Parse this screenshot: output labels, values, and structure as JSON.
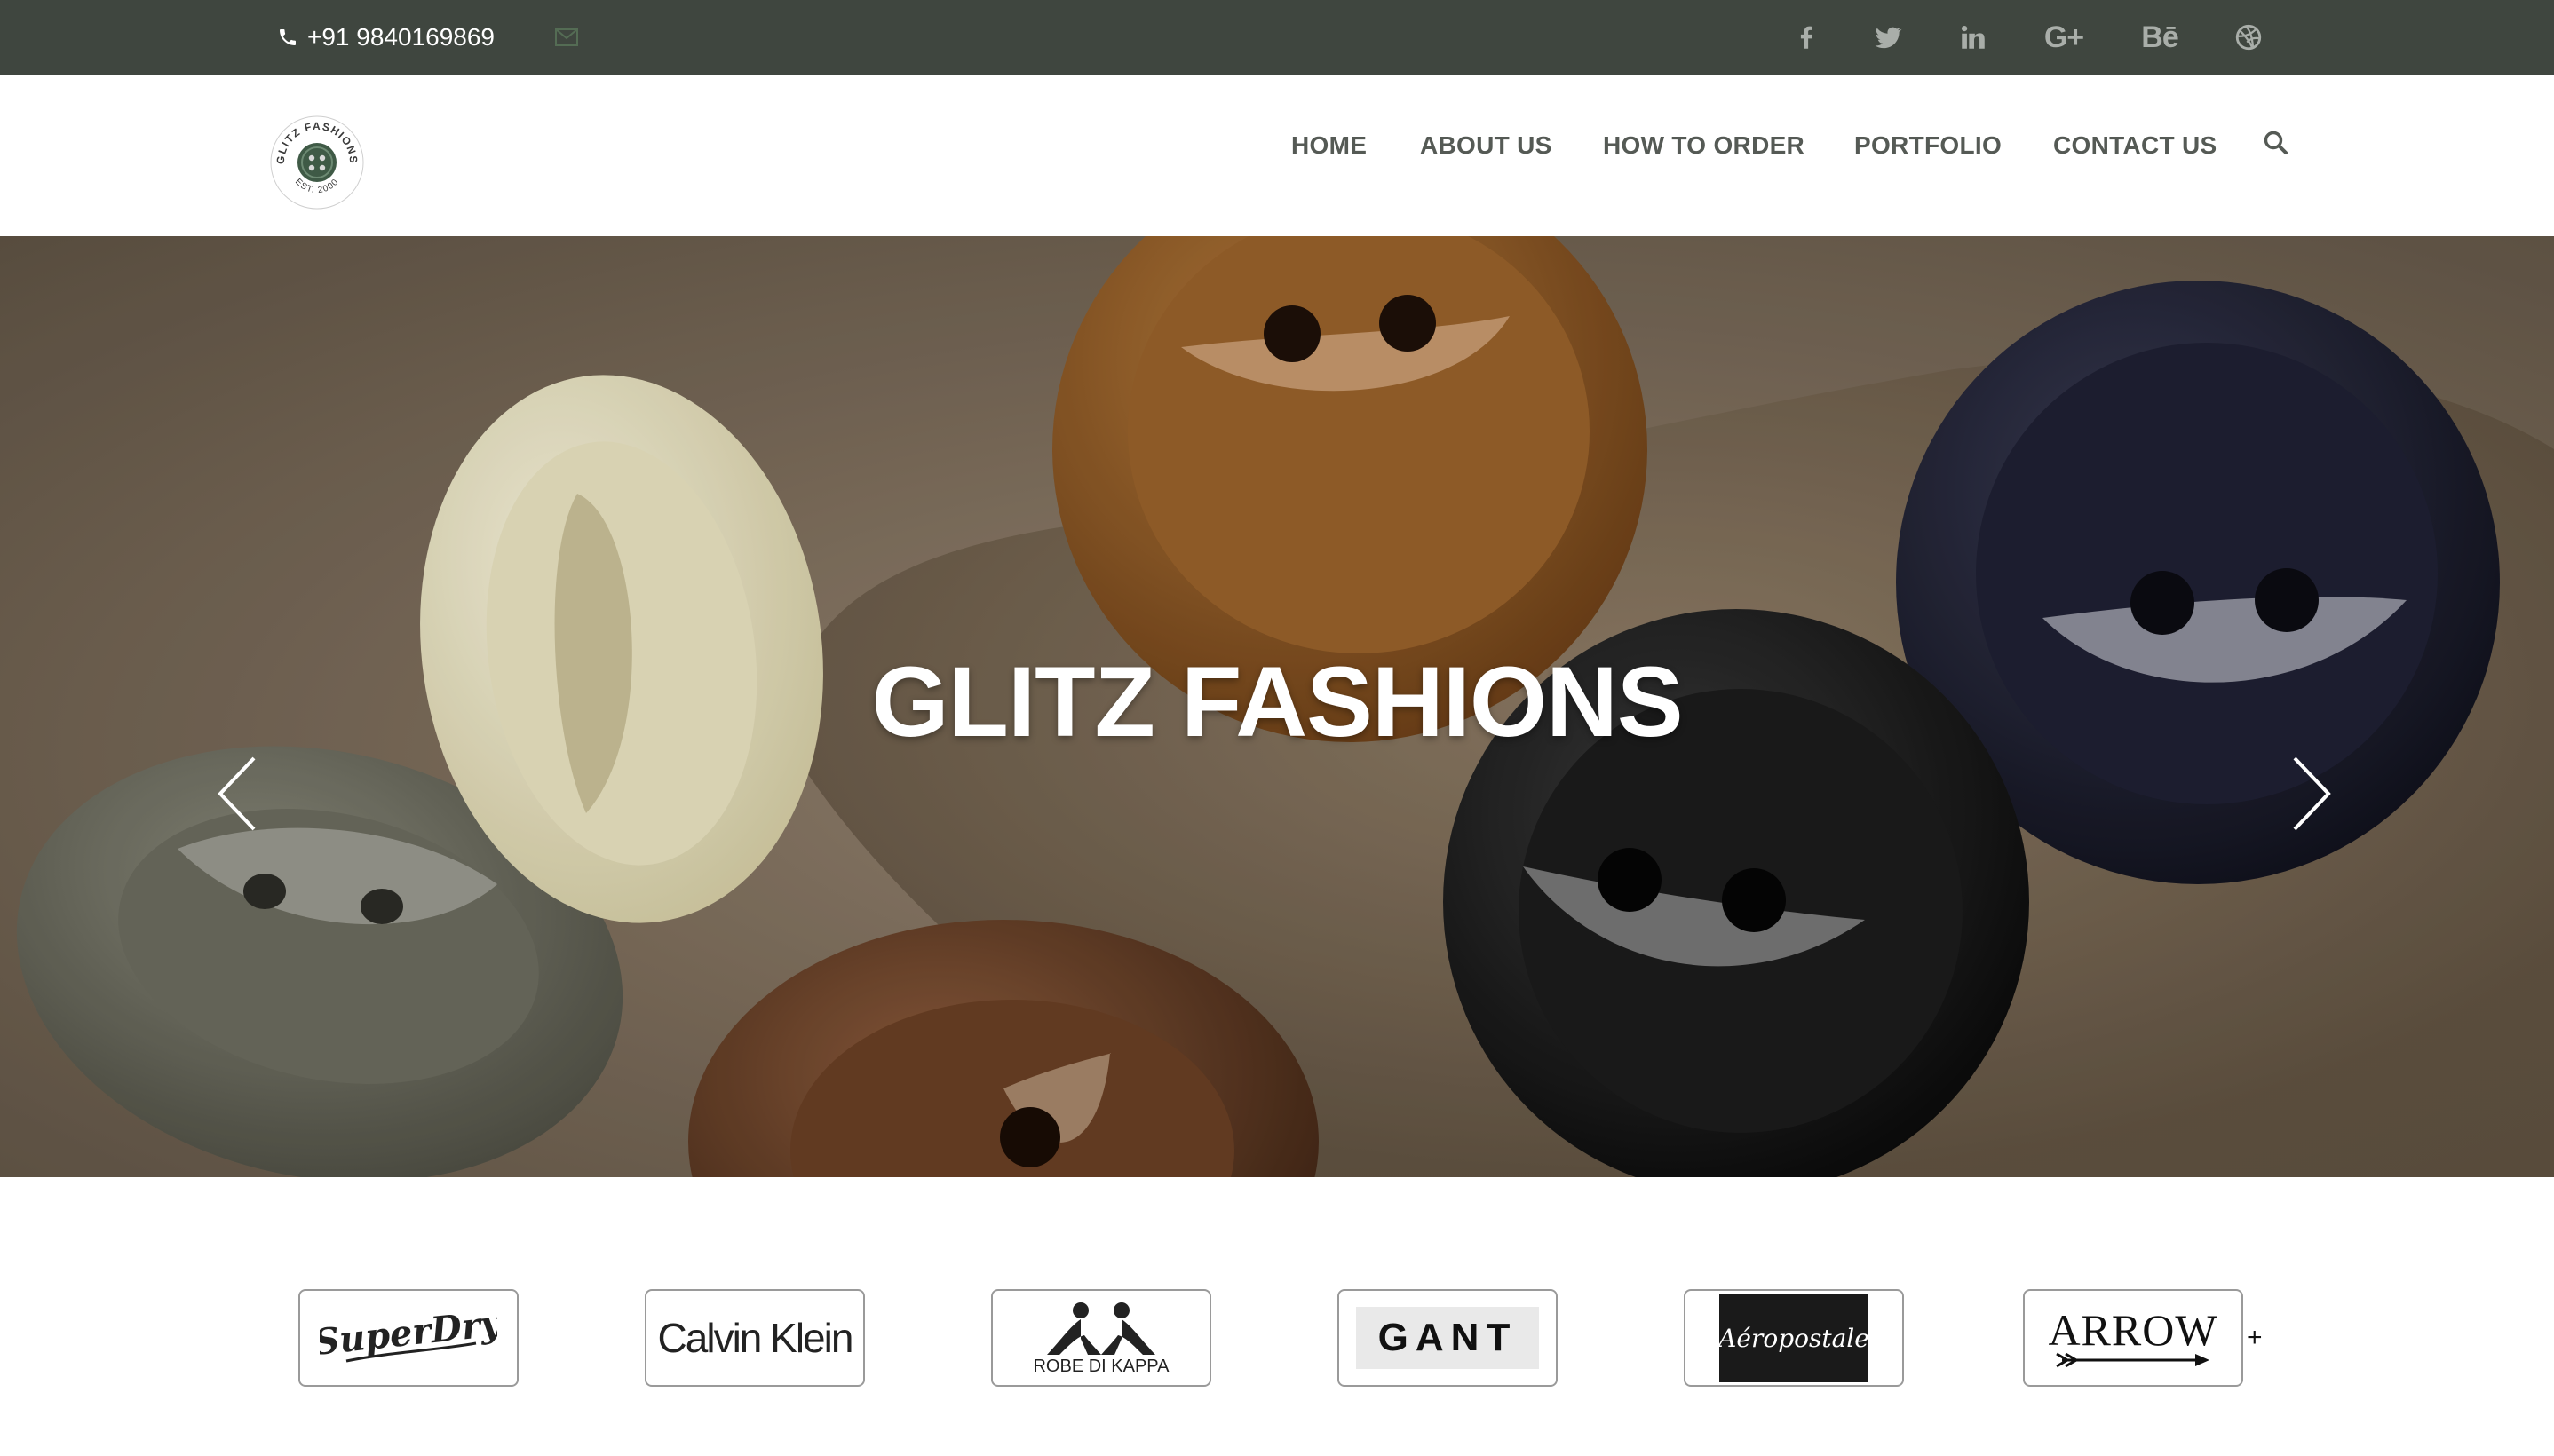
{
  "topbar": {
    "phone": "+91 9840169869",
    "icons": [
      "phone-icon",
      "mail-icon",
      "facebook-icon",
      "twitter-icon",
      "linkedin-icon",
      "google-plus-icon",
      "behance-icon",
      "dribbble-icon"
    ],
    "google_plus_glyph": "G+",
    "behance_glyph": "Bē"
  },
  "header": {
    "logo": {
      "ring_text": "GLITZ FASHIONS",
      "est": "EST. 2000"
    },
    "nav": [
      "HOME",
      "ABOUT US",
      "HOW TO ORDER",
      "PORTFOLIO",
      "CONTACT US"
    ],
    "search_icon": "search-icon"
  },
  "hero": {
    "title": "GLITZ FASHIONS",
    "prev_icon": "chevron-left-icon",
    "next_icon": "chevron-right-icon"
  },
  "brands": {
    "logos": [
      "SuperDry",
      "Calvin Klein",
      "ROBE DI KAPPA",
      "GANT",
      "Aéropostale",
      "ARROW"
    ],
    "more": "+"
  },
  "colors": {
    "topbar_bg": "#3f463f",
    "nav_text": "#555a55",
    "icon_grey": "#a9aea9",
    "logo_green": "#3f5a46"
  }
}
